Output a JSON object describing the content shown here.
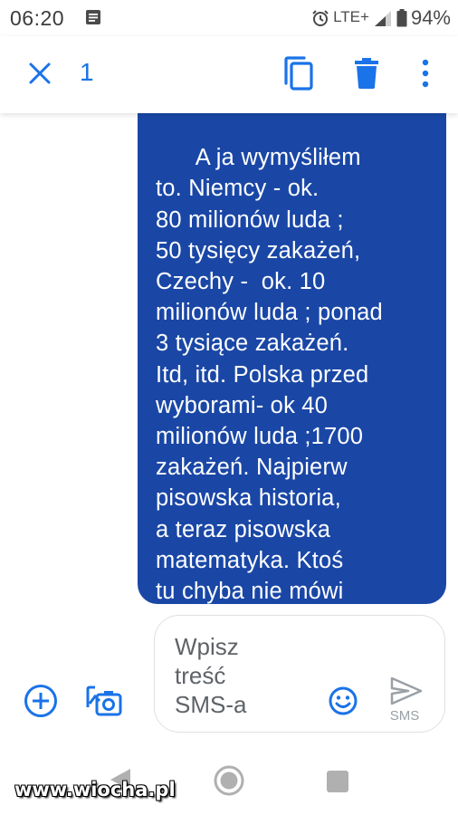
{
  "status_bar": {
    "time": "06:20",
    "network": "LTE+",
    "battery": "94%"
  },
  "action_bar": {
    "selected_count": "1",
    "icons": [
      "close-icon",
      "copy-icon",
      "delete-icon",
      "more-vert-icon"
    ],
    "accent_color": "#1a73e8"
  },
  "message": {
    "text": "A ja wymyśliłem\nto. Niemcy - ok.\n80 milionów luda ;\n50 tysięcy zakażeń,\nCzechy -  ok. 10\nmilionów luda ; ponad\n3 tysiące zakażeń.\nItd, itd. Polska przed\nwyborami- ok 40\nmilionów luda ;1700\nzakażeń. Najpierw\npisowska historia,\na teraz pisowska\nmatematyka. Ktoś\ntu chyba nie mówi\nprawdy?",
    "bubble_color": "#1a47a6"
  },
  "compose": {
    "placeholder": "Wpisz\ntreść\nSMS-a",
    "send_label": "SMS"
  },
  "watermark": "www.wiocha.pl"
}
